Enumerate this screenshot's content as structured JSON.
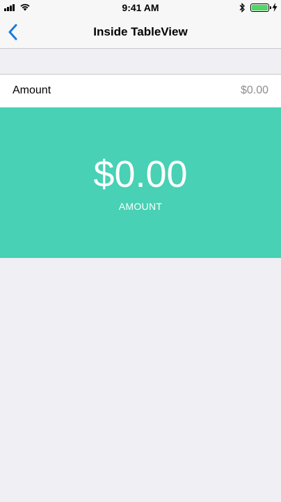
{
  "status_bar": {
    "time": "9:41 AM",
    "battery_level": 1.0,
    "icons": [
      "signal-icon",
      "wifi-icon",
      "bluetooth-icon",
      "battery-icon",
      "charging-icon"
    ]
  },
  "nav": {
    "title": "Inside TableView",
    "back_icon": "chevron-left-icon"
  },
  "row": {
    "label": "Amount",
    "value": "$0.00"
  },
  "panel": {
    "amount": "$0.00",
    "caption": "AMOUNT"
  },
  "colors": {
    "accent": "#1a7ae0",
    "panel": "#48d1b4",
    "background": "#efeff4",
    "battery": "#4cd964"
  }
}
